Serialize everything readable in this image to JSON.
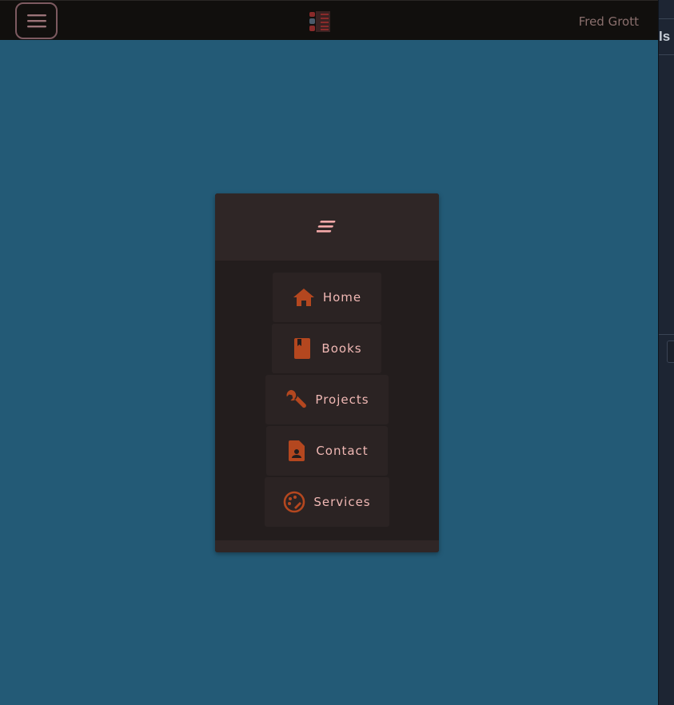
{
  "topbar": {
    "user_name": "Fred Grott"
  },
  "side_window": {
    "heading_fragment": "ls "
  },
  "nav_menu": {
    "items": [
      {
        "label": "Home",
        "icon": "home-icon"
      },
      {
        "label": "Books",
        "icon": "book-icon"
      },
      {
        "label": "Projects",
        "icon": "wrench-icon"
      },
      {
        "label": "Contact",
        "icon": "contact-icon"
      },
      {
        "label": "Services",
        "icon": "palette-icon"
      }
    ]
  },
  "colors": {
    "page_bg": "#235a76",
    "topbar_bg": "#110f0d",
    "panel_bg": "#231d1d",
    "panel_header_bg": "#2f2626",
    "item_bg": "#2b2323",
    "icon_color": "#b4471f",
    "label_color": "#f0b8b4",
    "accent_pink": "#f5a9a9"
  }
}
